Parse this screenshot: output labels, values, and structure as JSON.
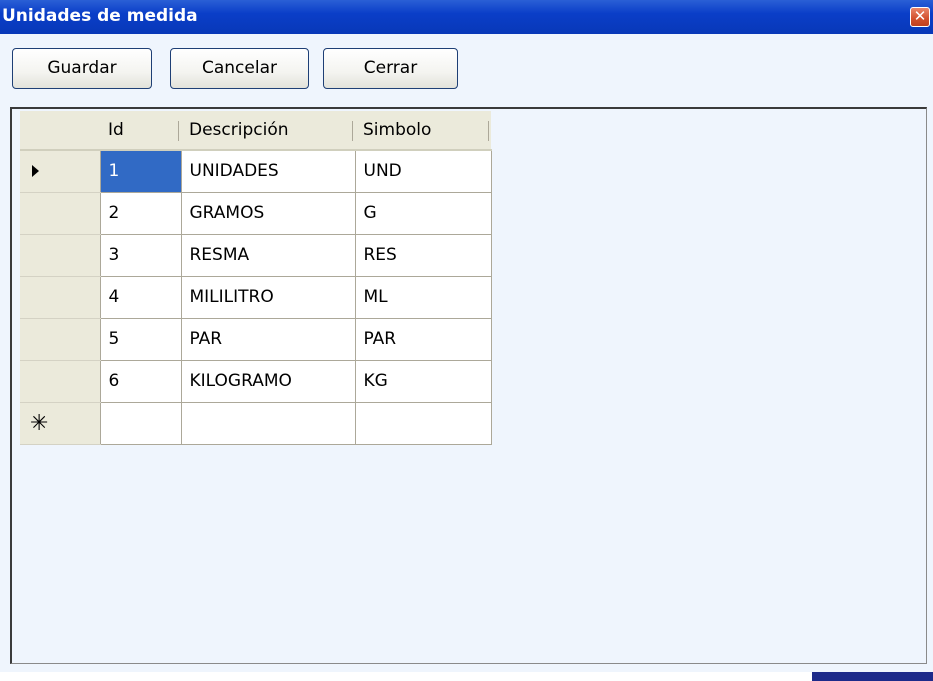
{
  "window": {
    "title": "Unidades de medida",
    "close_glyph": "✕",
    "accent_color": "#0a3ec8"
  },
  "toolbar": {
    "guardar_label": "Guardar",
    "cancelar_label": "Cancelar",
    "cerrar_label": "Cerrar"
  },
  "grid": {
    "columns": [
      "Id",
      "Descripción",
      "Simbolo"
    ],
    "rows": [
      {
        "id": "1",
        "descripcion": "UNIDADES",
        "simbolo": "UND"
      },
      {
        "id": "2",
        "descripcion": "GRAMOS",
        "simbolo": "G"
      },
      {
        "id": "3",
        "descripcion": "RESMA",
        "simbolo": "RES"
      },
      {
        "id": "4",
        "descripcion": "MILILITRO",
        "simbolo": "ML"
      },
      {
        "id": "5",
        "descripcion": "PAR",
        "simbolo": "PAR"
      },
      {
        "id": "6",
        "descripcion": "KILOGRAMO",
        "simbolo": "KG"
      }
    ],
    "selected_row": 0,
    "new_row_glyph": "✳",
    "current_row_icon": "current-row-arrow-icon",
    "new_row_icon": "new-row-asterisk-icon",
    "selection_color": "#316ac5"
  }
}
